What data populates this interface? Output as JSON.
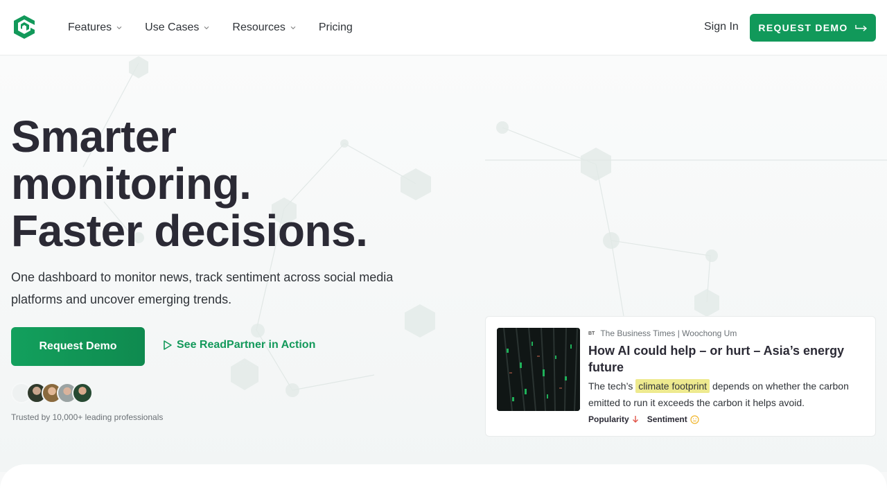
{
  "nav": {
    "items": [
      {
        "label": "Features",
        "has_dropdown": true
      },
      {
        "label": "Use Cases",
        "has_dropdown": true
      },
      {
        "label": "Resources",
        "has_dropdown": true
      },
      {
        "label": "Pricing",
        "has_dropdown": false
      }
    ],
    "sign_in": "Sign In",
    "cta": "REQUEST DEMO"
  },
  "hero": {
    "headline": [
      "Smarter",
      "monitoring.",
      "Faster decisions."
    ],
    "subtext": "One dashboard to monitor news, track sentiment across social media platforms and uncover emerging trends.",
    "primary_button": "Request Demo",
    "secondary_link": "See ReadPartner in Action",
    "trusted": "Trusted by 10,000+ leading professionals"
  },
  "article_card": {
    "source_logo": "BT",
    "source": "The Business Times | Woochong Um",
    "title": "How AI could help – or hurt – Asia’s energy future",
    "desc_before": "The tech’s ",
    "desc_highlight": "climate footprint",
    "desc_after": " depends on whether the carbon emitted to run it exceeds the carbon it helps avoid.",
    "metrics": [
      {
        "label": "Popularity",
        "icon": "arrow-down-icon"
      },
      {
        "label": "Sentiment",
        "icon": "neutral-face-icon"
      }
    ]
  },
  "colors": {
    "brand_green": "#11995a",
    "heading": "#2b2a35",
    "highlight": "#eeea8f",
    "popularity_down": "#e0554a",
    "sentiment_neutral": "#f0b429"
  }
}
